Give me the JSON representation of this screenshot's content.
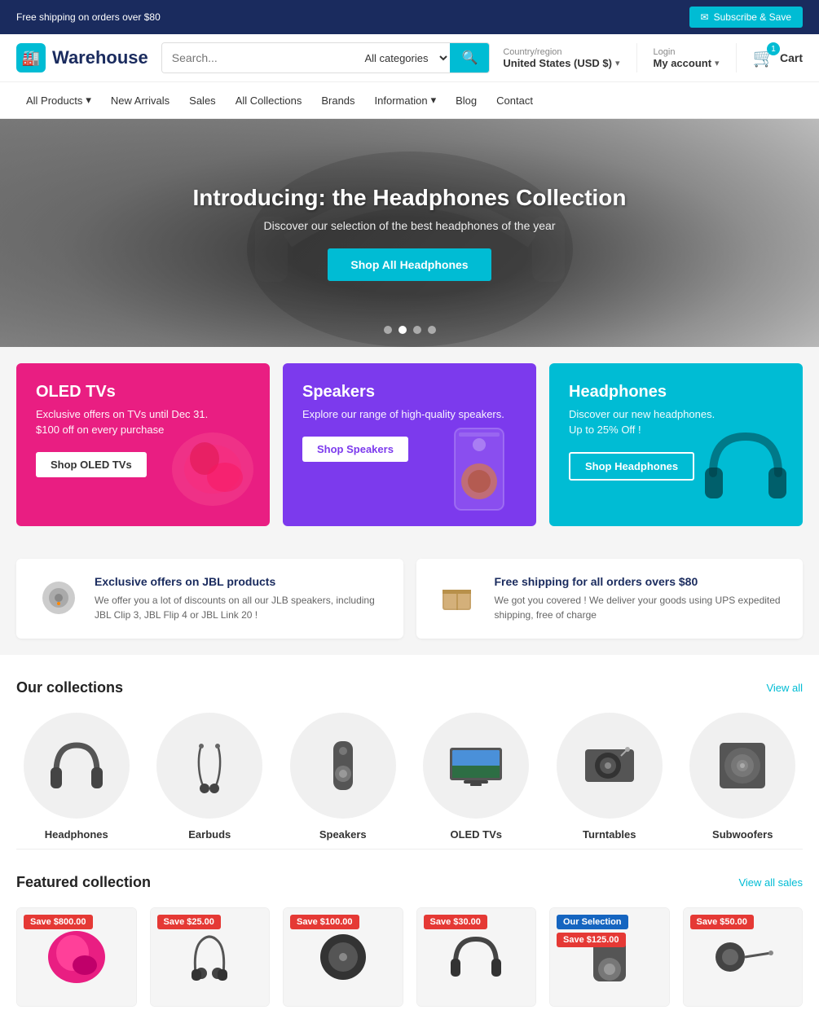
{
  "topbar": {
    "shipping_text": "Free shipping on orders over $80",
    "subscribe_label": "Subscribe & Save"
  },
  "header": {
    "logo_text": "Warehouse",
    "search_placeholder": "Search...",
    "categories_label": "All categories",
    "country_label": "Country/region",
    "country_value": "United States (USD $)",
    "login_label": "Login",
    "account_label": "My account",
    "cart_label": "Cart",
    "cart_count": "1"
  },
  "nav": {
    "items": [
      {
        "label": "All Products",
        "has_dropdown": true
      },
      {
        "label": "New Arrivals",
        "has_dropdown": false
      },
      {
        "label": "Sales",
        "has_dropdown": false
      },
      {
        "label": "All Collections",
        "has_dropdown": false
      },
      {
        "label": "Brands",
        "has_dropdown": false
      },
      {
        "label": "Information",
        "has_dropdown": true
      },
      {
        "label": "Blog",
        "has_dropdown": false
      },
      {
        "label": "Contact",
        "has_dropdown": false
      }
    ]
  },
  "hero": {
    "title": "Introducing: the Headphones Collection",
    "subtitle": "Discover our selection of the best headphones of the year",
    "cta_label": "Shop All Headphones",
    "dots": 4,
    "active_dot": 2
  },
  "promo_cards": [
    {
      "title": "OLED TVs",
      "desc1": "Exclusive offers on TVs until Dec 31.",
      "desc2": "$100 off on every purchase",
      "btn_label": "Shop OLED TVs",
      "color": "pink"
    },
    {
      "title": "Speakers",
      "desc1": "Explore our range of high-quality speakers.",
      "desc2": "",
      "btn_label": "Shop Speakers",
      "color": "purple"
    },
    {
      "title": "Headphones",
      "desc1": "Discover our new headphones.",
      "desc2": "Up to 25% Off !",
      "btn_label": "Shop Headphones",
      "color": "teal"
    }
  ],
  "info_banners": [
    {
      "icon": "🔊",
      "title": "Exclusive offers on JBL products",
      "desc": "We offer you a lot of discounts on all our JLB speakers, including JBL Clip 3, JBL Flip 4 or JBL Link 20 !"
    },
    {
      "icon": "📦",
      "title": "Free shipping for all orders overs $80",
      "desc": "We got you covered ! We deliver your goods using UPS expedited shipping, free of charge"
    }
  ],
  "collections": {
    "heading": "Our collections",
    "view_all": "View all",
    "items": [
      {
        "label": "Headphones",
        "icon": "🎧"
      },
      {
        "label": "Earbuds",
        "icon": "🎵"
      },
      {
        "label": "Speakers",
        "icon": "🔊"
      },
      {
        "label": "OLED TVs",
        "icon": "📺"
      },
      {
        "label": "Turntables",
        "icon": "💿"
      },
      {
        "label": "Subwoofers",
        "icon": "🔈"
      }
    ]
  },
  "featured": {
    "heading": "Featured collection",
    "view_all": "View all sales",
    "products": [
      {
        "badge": "Save $800.00",
        "badge_color": "red",
        "icon": "🌺"
      },
      {
        "badge": "Save $25.00",
        "badge_color": "red",
        "icon": "🎵"
      },
      {
        "badge": "Save $100.00",
        "badge_color": "red",
        "icon": "💿"
      },
      {
        "badge": "Save $30.00",
        "badge_color": "red",
        "icon": "🎧"
      },
      {
        "badge": "Our Selection",
        "badge_color": "blue",
        "badge2": "Save $125.00",
        "badge2_color": "red",
        "icon": "🔊"
      },
      {
        "badge": "Save $50.00",
        "badge_color": "red",
        "icon": "🎙️"
      }
    ]
  }
}
